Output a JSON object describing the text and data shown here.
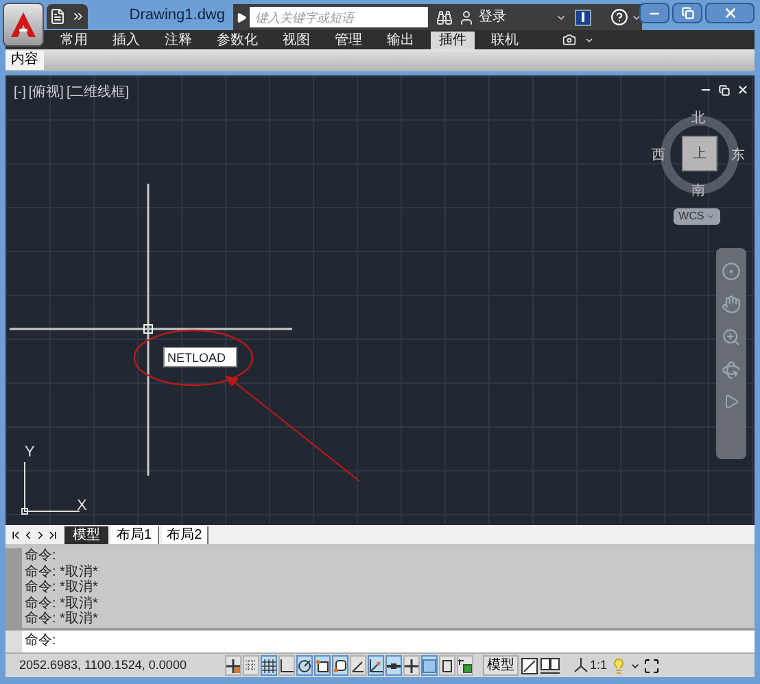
{
  "title_bar": {
    "document_title": "Drawing1.dwg",
    "search": {
      "placeholder": "键入关键字或短语"
    },
    "sign_in": "登录"
  },
  "ribbon_tabs": [
    {
      "label": "常用",
      "selected": false
    },
    {
      "label": "插入",
      "selected": false
    },
    {
      "label": "注释",
      "selected": false
    },
    {
      "label": "参数化",
      "selected": false
    },
    {
      "label": "视图",
      "selected": false
    },
    {
      "label": "管理",
      "selected": false
    },
    {
      "label": "输出",
      "selected": false
    },
    {
      "label": "插件",
      "selected": true
    },
    {
      "label": "联机",
      "selected": false
    }
  ],
  "panel_tabs": [
    {
      "label": "内容",
      "selected": true
    }
  ],
  "viewport": {
    "controls": [
      "[-]",
      "[俯视]",
      "[二维线框]"
    ],
    "viewcube": {
      "north": "北",
      "south": "南",
      "east": "东",
      "west": "西",
      "face": "上"
    },
    "ucs_menu": "WCS",
    "dynamic_input": "NETLOAD",
    "axis_x": "X",
    "axis_y": "Y"
  },
  "layout_tabs": [
    {
      "label": "模型",
      "selected": true
    },
    {
      "label": "布局1",
      "selected": false
    },
    {
      "label": "布局2",
      "selected": false
    }
  ],
  "command_history": [
    "命令:",
    "命令: *取消*",
    "命令: *取消*",
    "命令: *取消*",
    "命令: *取消*"
  ],
  "command_prompt": "命令:",
  "status_bar": {
    "coordinates": "2052.6983, 1100.1524, 0.0000",
    "toggles": [
      {
        "kind": "infer",
        "on": false
      },
      {
        "kind": "snap",
        "on": false
      },
      {
        "kind": "grid",
        "on": true
      },
      {
        "kind": "ortho",
        "on": false
      },
      {
        "kind": "polar",
        "on": true
      },
      {
        "kind": "osnap",
        "on": true
      },
      {
        "kind": "osnap3d",
        "on": true
      },
      {
        "kind": "otrack",
        "on": false
      },
      {
        "kind": "ducs",
        "on": true
      },
      {
        "kind": "dyn",
        "on": true
      },
      {
        "kind": "lineweight",
        "on": false
      },
      {
        "kind": "transparency",
        "on": true
      },
      {
        "kind": "quickprops",
        "on": false
      },
      {
        "kind": "selcycle",
        "on": false
      }
    ],
    "model_button": "模型",
    "annotation_scale": "1:1"
  }
}
